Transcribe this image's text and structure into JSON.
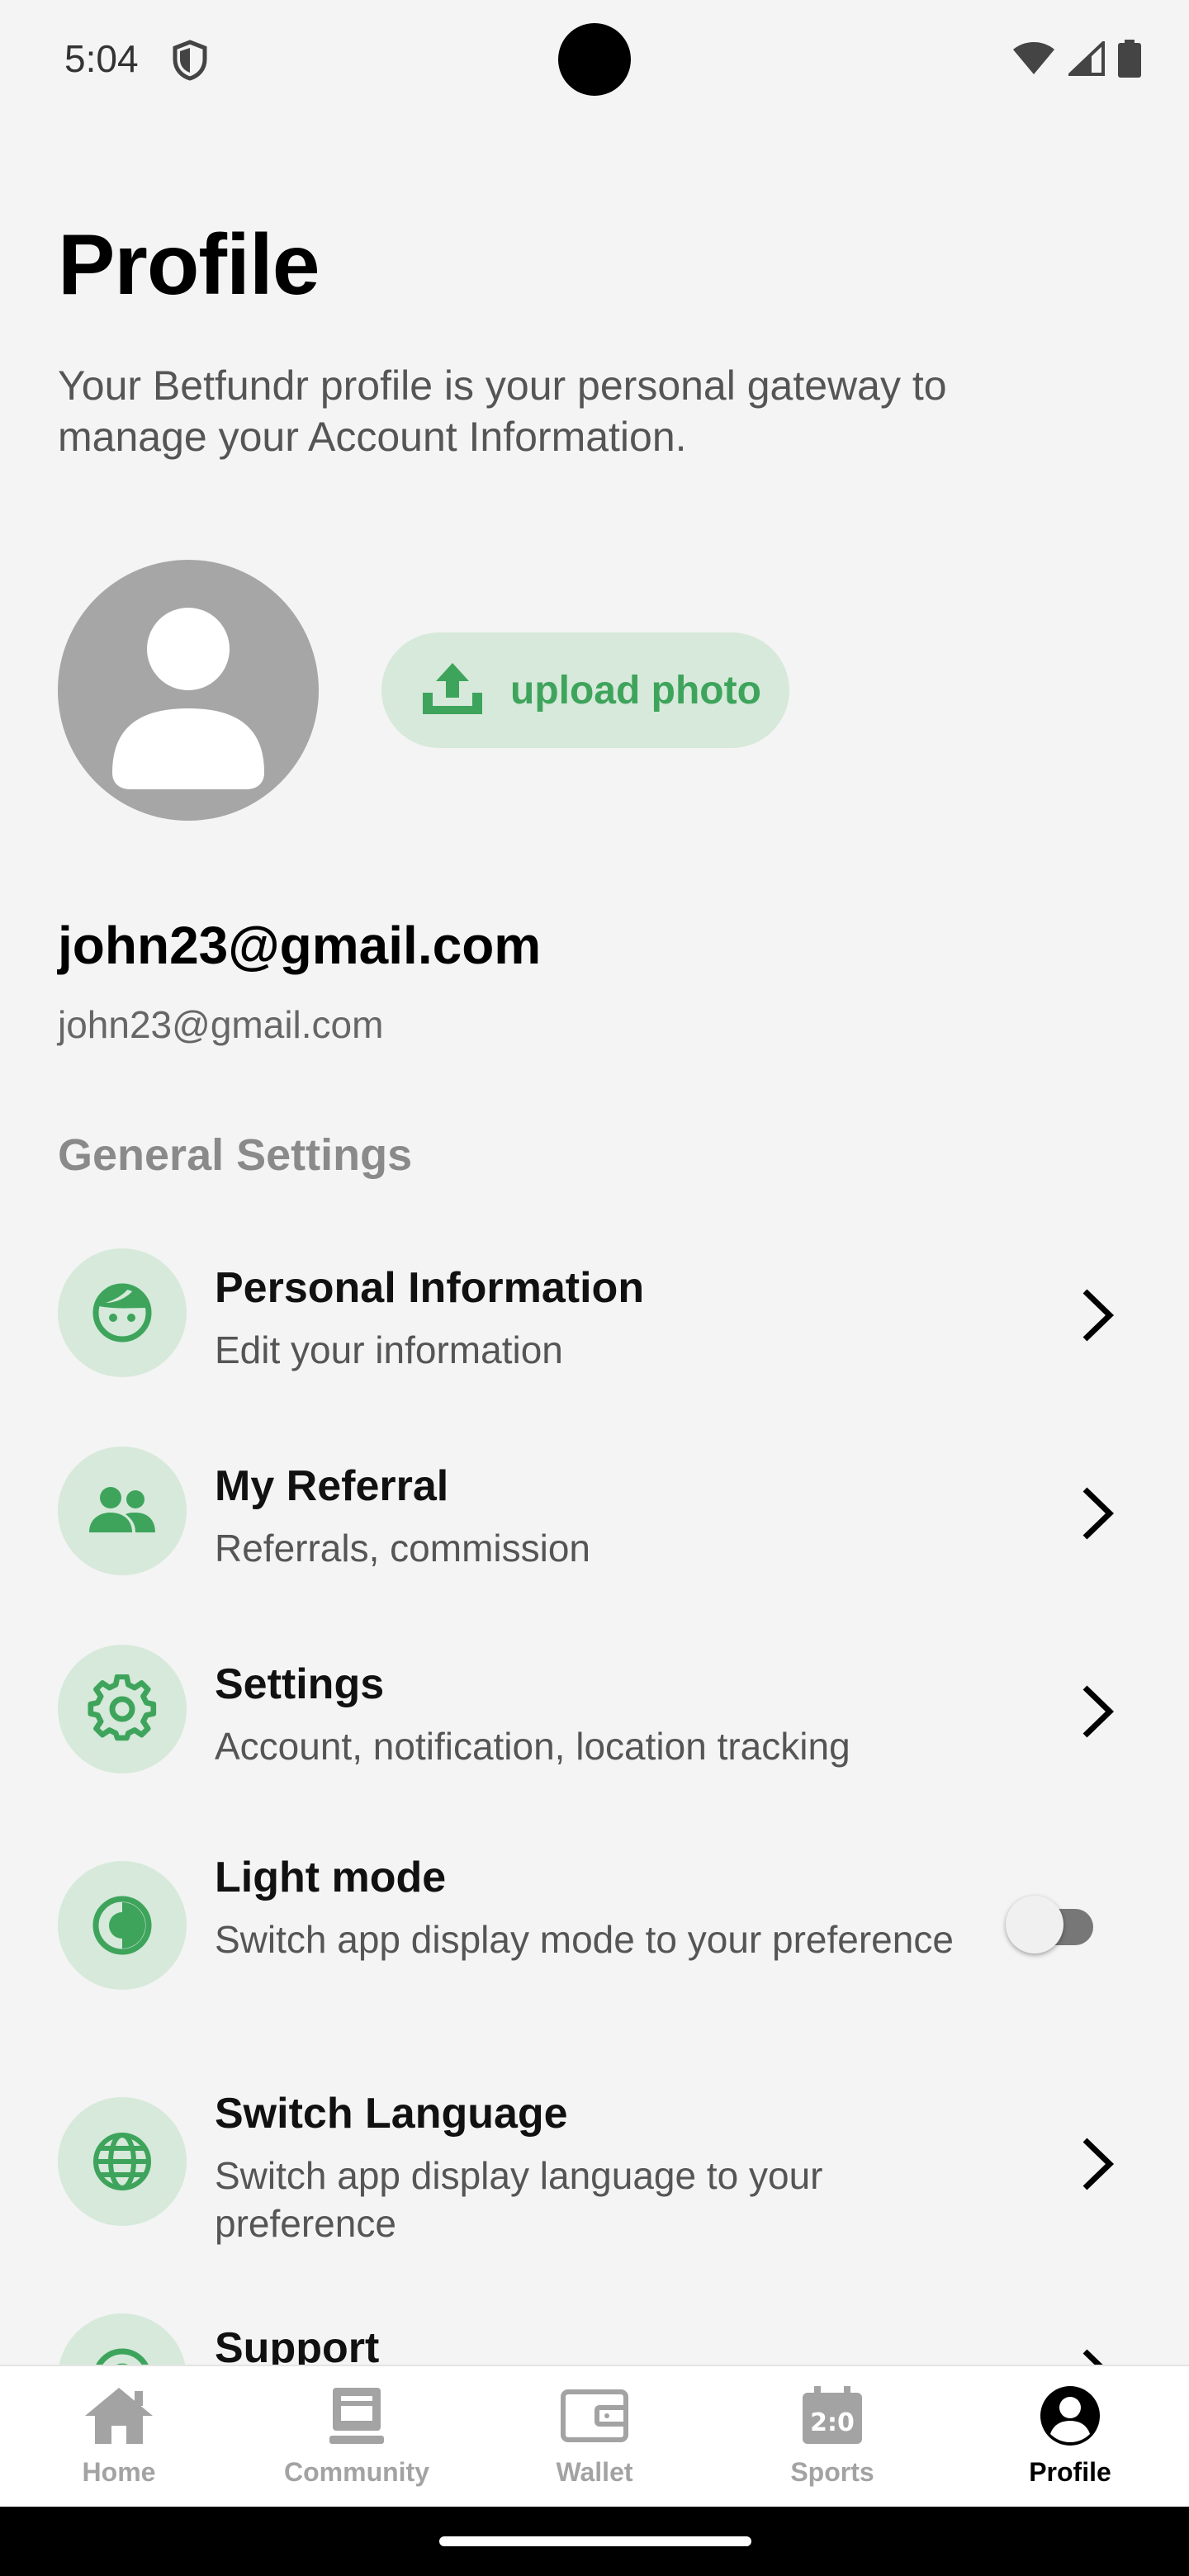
{
  "status_bar": {
    "time": "5:04",
    "icons": [
      "shield-icon",
      "wifi-icon",
      "signal-icon",
      "battery-icon"
    ]
  },
  "header": {
    "title": "Profile",
    "description": "Your Betfundr profile is your personal gateway to manage your Account Information."
  },
  "avatar": {
    "icon": "person-icon",
    "upload_label": "upload photo",
    "upload_icon": "upload-icon"
  },
  "user": {
    "name": "john23@gmail.com",
    "email": "john23@gmail.com"
  },
  "general_settings": {
    "title": "General Settings",
    "items": [
      {
        "title": "Personal Information",
        "subtitle": "Edit your information",
        "icon": "face-icon",
        "control": "chevron"
      },
      {
        "title": "My Referral",
        "subtitle": "Referrals, commission",
        "icon": "people-icon",
        "control": "chevron"
      },
      {
        "title": "Settings",
        "subtitle": "Account, notification, location tracking",
        "icon": "gear-icon",
        "control": "chevron"
      },
      {
        "title": "Light mode",
        "subtitle": "Switch app display mode to your preference",
        "icon": "contrast-icon",
        "control": "toggle",
        "toggle_on": false
      },
      {
        "title": "Switch Language",
        "subtitle": "Switch app display language to your preference",
        "icon": "globe-icon",
        "control": "chevron"
      },
      {
        "title": "Support",
        "subtitle": "",
        "icon": "support-icon",
        "control": "chevron"
      }
    ]
  },
  "bottom_nav": {
    "items": [
      {
        "label": "Home",
        "icon": "home-icon",
        "active": false
      },
      {
        "label": "Community",
        "icon": "community-icon",
        "active": false
      },
      {
        "label": "Wallet",
        "icon": "wallet-icon",
        "active": false
      },
      {
        "label": "Sports",
        "icon": "scoreboard-icon",
        "active": false
      },
      {
        "label": "Profile",
        "icon": "profile-icon",
        "active": true
      }
    ]
  },
  "colors": {
    "background": "#f4f4f4",
    "accent": "#3ea45c",
    "accent_soft": "#d6e9da",
    "avatar_gray": "#a6a6a6",
    "inactive_nav": "#a3a3a3"
  }
}
